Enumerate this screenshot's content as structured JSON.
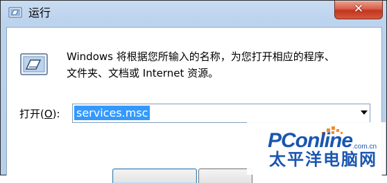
{
  "window": {
    "title": "运行",
    "close_glyph": "✕",
    "title_icon": "run-app-icon"
  },
  "content": {
    "icon": "run-icon",
    "description_line1": "Windows 将根据您所输入的名称，为您打开相应的程序、",
    "description_line2": "文件夹、文档或 Internet 资源。"
  },
  "open_field": {
    "label_prefix": "打开(",
    "label_mnemonic": "O",
    "label_suffix": "):",
    "value": "services.msc"
  },
  "watermark": {
    "brand": "PConline",
    "domain": ".com.cn",
    "cn": "太平洋电脑网"
  },
  "colors": {
    "accent_selection": "#3399ff",
    "brand_blue": "#1a56b0",
    "close_red": "#c2351f"
  }
}
